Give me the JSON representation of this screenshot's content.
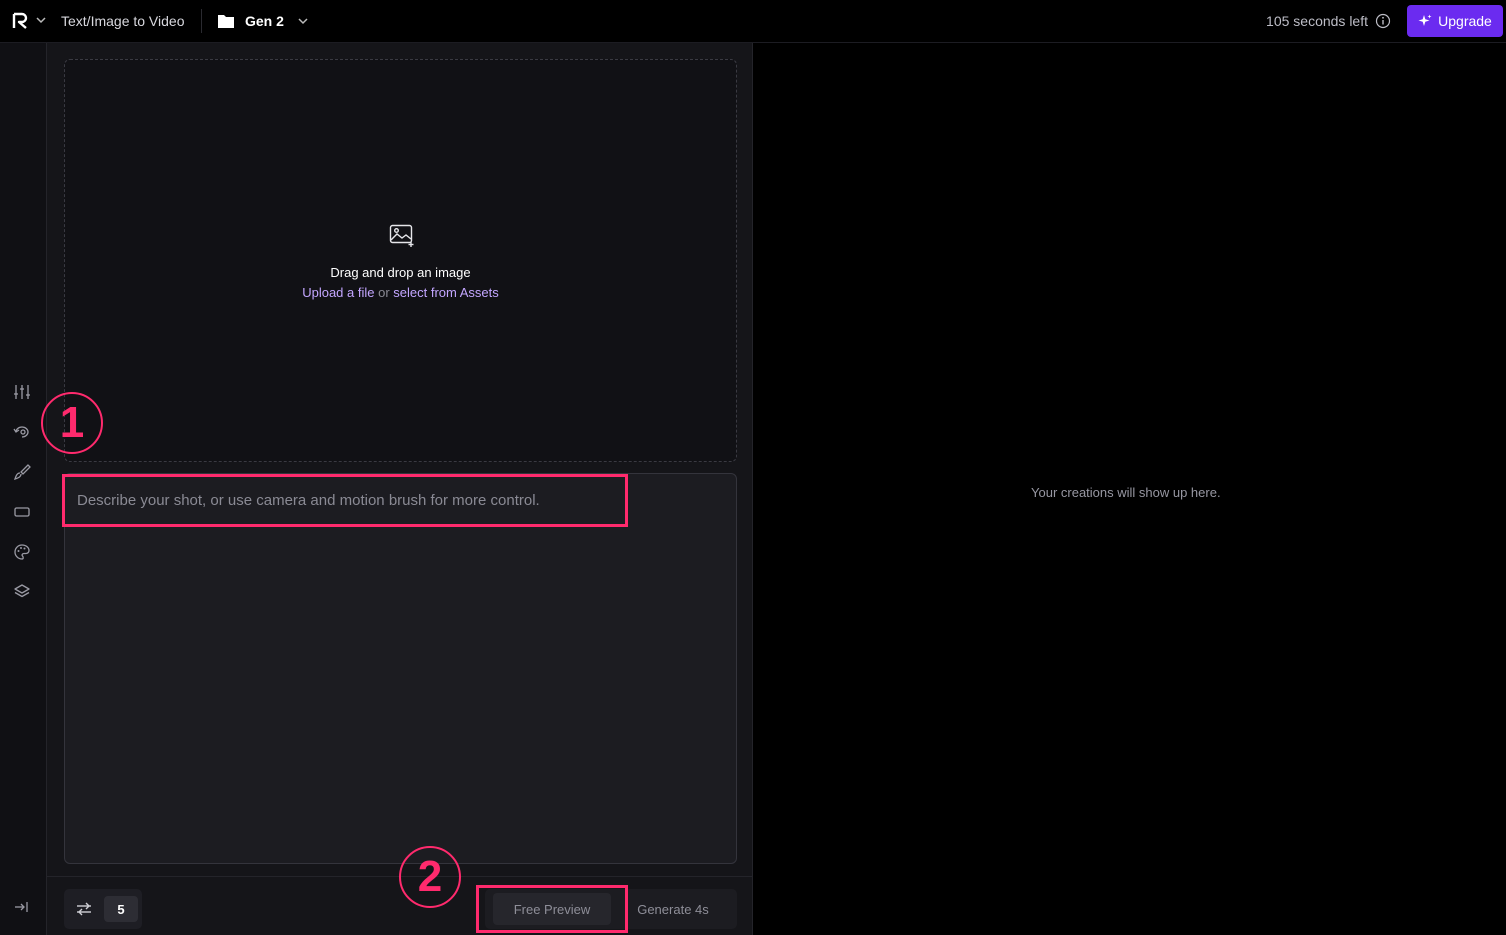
{
  "header": {
    "mode_label": "Text/Image to Video",
    "project_label": "Gen 2",
    "time_left": "105 seconds left",
    "upgrade_label": "Upgrade"
  },
  "rail": {
    "icons": [
      "sliders-icon",
      "camera-motion-icon",
      "brush-icon",
      "aspect-ratio-icon",
      "palette-icon",
      "layers-icon",
      "collapse-panel-icon"
    ]
  },
  "dropzone": {
    "title": "Drag and drop an image",
    "upload_link": "Upload a file",
    "or_text": "or",
    "assets_link": "select from Assets"
  },
  "prompt": {
    "placeholder": "Describe your shot, or use camera and motion brush for more control.",
    "value": ""
  },
  "footer": {
    "seed_count": "5",
    "free_preview_label": "Free Preview",
    "generate_label": "Generate 4s"
  },
  "annotations": {
    "step1": "1",
    "step2": "2"
  },
  "output": {
    "empty_message": "Your creations will show up here."
  },
  "colors": {
    "accent": "#6b2bf0",
    "link": "#c3a6ff",
    "annotation": "#ff2a6d"
  }
}
